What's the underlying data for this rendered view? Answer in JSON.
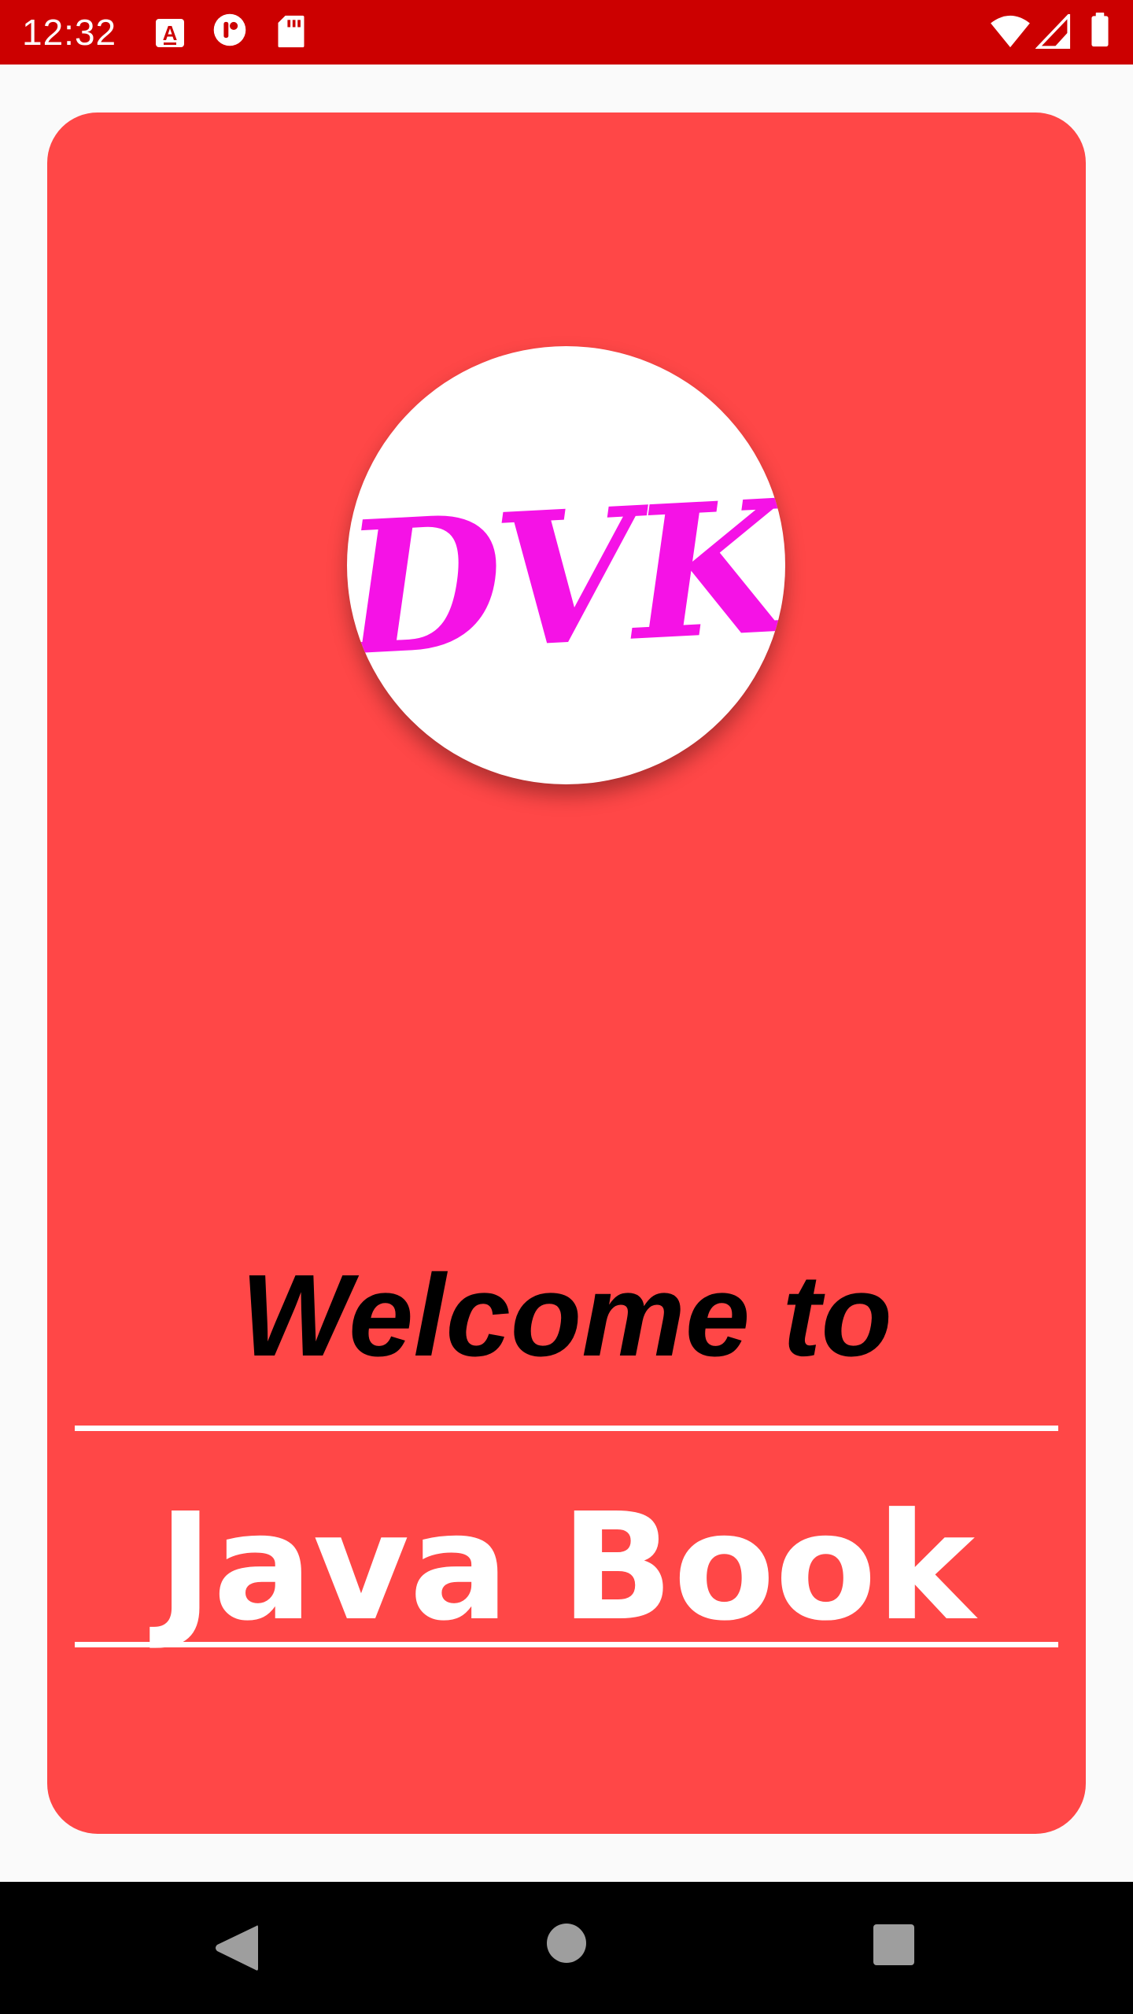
{
  "status_bar": {
    "time": "12:32",
    "background_color": "#cc0000",
    "notification_icons": [
      "a-notification-icon",
      "circle-r-notification-icon",
      "sd-card-icon"
    ],
    "system_icons": [
      "wifi-icon",
      "cell-signal-icon",
      "battery-icon"
    ]
  },
  "card": {
    "background_color": "#ff4747",
    "logo": {
      "text": "DVK",
      "text_color": "#f512e6",
      "background_color": "#ffffff"
    },
    "welcome_text": "Welcome to",
    "app_name": "Java Book"
  },
  "nav_bar": {
    "buttons": [
      "back-icon",
      "home-icon",
      "recents-icon"
    ]
  }
}
